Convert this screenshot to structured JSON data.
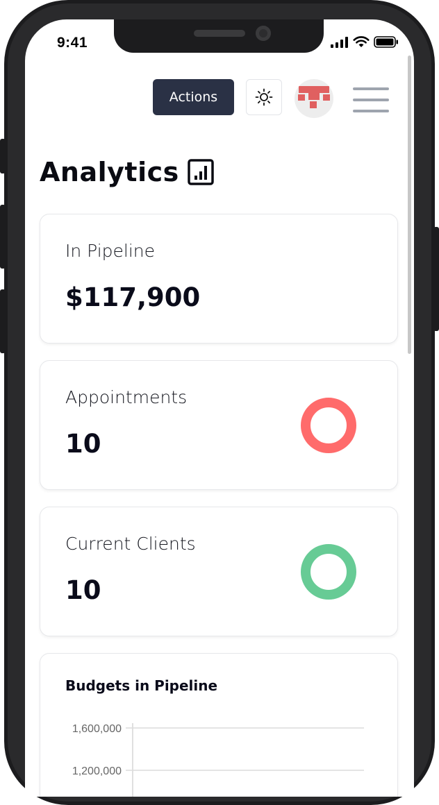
{
  "status_bar": {
    "time": "9:41"
  },
  "toolbar": {
    "actions_label": "Actions"
  },
  "page": {
    "title": "Analytics"
  },
  "cards": [
    {
      "label": "In Pipeline",
      "value": "$117,900"
    },
    {
      "label": "Appointments",
      "value": "10",
      "ring_color": "#ff6b6b"
    },
    {
      "label": "Current Clients",
      "value": "10",
      "ring_color": "#67cb95"
    }
  ],
  "colors": {
    "accent_dark": "#2a3145",
    "ring_red": "#ff6b6b",
    "ring_green": "#67cb95",
    "avatar_red": "#e06060"
  },
  "icons": {
    "theme": "sun-icon",
    "menu": "hamburger-icon",
    "title": "bar-chart-icon"
  },
  "chart_data": {
    "type": "bar",
    "title": "Budgets in Pipeline",
    "xlabel": "",
    "ylabel": "",
    "ylim": [
      0,
      1600000
    ],
    "yticks": [
      "1,600,000",
      "1,200,000"
    ],
    "categories": [],
    "values": []
  }
}
